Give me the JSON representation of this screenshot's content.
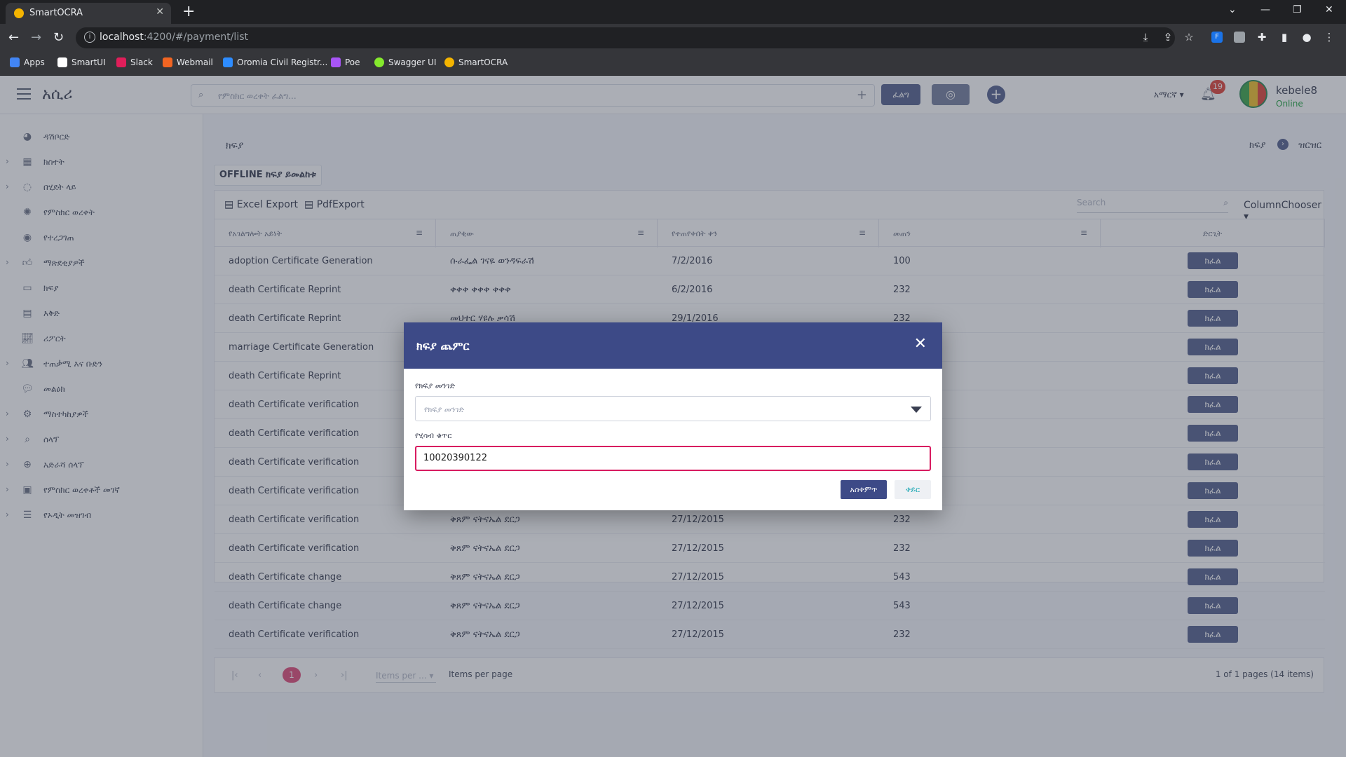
{
  "browser": {
    "tab_title": "SmartOCRA",
    "url_host": "localhost",
    "url_path": ":4200/#/payment/list",
    "bookmarks": [
      {
        "label": "Apps",
        "color": "#4285f4"
      },
      {
        "label": "SmartUI",
        "color": "#ffffff"
      },
      {
        "label": "Slack",
        "color": "#e01e5a"
      },
      {
        "label": "Webmail",
        "color": "#f26522"
      },
      {
        "label": "Oromia Civil Registr...",
        "color": "#2d8cff"
      },
      {
        "label": "Poe",
        "color": "#a855f7"
      },
      {
        "label": "Swagger UI",
        "color": "#85ea2d"
      },
      {
        "label": "SmartOCRA",
        "color": "#f4b400"
      }
    ]
  },
  "app": {
    "brand": "አሲሪ",
    "search_placeholder": "የምስክር ወረቀት ፈልግ...",
    "search_button": "ፈልግ",
    "language": "አማርኛ",
    "notifications": "19",
    "user": {
      "name": "kebele8",
      "status": "Online"
    }
  },
  "sidebar": {
    "items": [
      {
        "label": "ዳሽቦርድ",
        "icon": "dashboard-icon",
        "has_children": false
      },
      {
        "label": "ክስተት",
        "icon": "calendar-icon",
        "has_children": true
      },
      {
        "label": "በሂደት ላይ",
        "icon": "spinner-icon",
        "has_children": true
      },
      {
        "label": "የምስክር ወረቀት",
        "icon": "certificate-icon",
        "has_children": false
      },
      {
        "label": "የተረጋገጠ",
        "icon": "check-circle-icon",
        "has_children": false
      },
      {
        "label": "ማጽደቂያዎች",
        "icon": "thumbs-up-icon",
        "has_children": true
      },
      {
        "label": "ክፍያ",
        "icon": "credit-card-icon",
        "has_children": false
      },
      {
        "label": "እቅድ",
        "icon": "planner-icon",
        "has_children": false
      },
      {
        "label": "ሪፖርት",
        "icon": "chart-line-icon",
        "has_children": false
      },
      {
        "label": "ተጠቃሚ እና ቡድን",
        "icon": "users-icon",
        "has_children": true
      },
      {
        "label": "መልዕክ",
        "icon": "chat-icon",
        "has_children": false
      },
      {
        "label": "ማስተካከያዎች",
        "icon": "settings-icon",
        "has_children": true
      },
      {
        "label": "ሰላፕ",
        "icon": "zoom-icon",
        "has_children": true
      },
      {
        "label": "አድራሻ ሰላፕ",
        "icon": "zoom-plus-icon",
        "has_children": true
      },
      {
        "label": "የምስክር ወረቀቶች መገኛ",
        "icon": "archive-icon",
        "has_children": true
      },
      {
        "label": "የኦዲት መዝገብ",
        "icon": "list-icon",
        "has_children": true
      }
    ]
  },
  "page": {
    "title": "ክፍያ",
    "breadcrumb": [
      "ክፍያ",
      "ዝርዝር"
    ],
    "offline_button": "OFFLINE ክፍያ ይመልከቱ",
    "excel_export": "Excel Export",
    "pdf_export": "PdfExport",
    "grid_search_placeholder": "Search",
    "column_chooser": "ColumnChooser",
    "columns": [
      "የአገልግሎት አይነት",
      "ጠያቂው",
      "የተጠየቀበት ቀን",
      "መጠን",
      "ድርጊት"
    ],
    "pay_button": "ክፈል",
    "rows": [
      {
        "type": "adoption Certificate Generation",
        "requester": "ሱራፌል ገናዬ ወንዳፍራሽ",
        "date": "7/2/2016",
        "amount": "100"
      },
      {
        "type": "death Certificate Reprint",
        "requester": "ቀቀቀ ቀቀቀ ቀቀቀ",
        "date": "6/2/2016",
        "amount": "232"
      },
      {
        "type": "death Certificate Reprint",
        "requester": "መህተር ሃዩሉ ቃሳሽ",
        "date": "29/1/2016",
        "amount": "232"
      },
      {
        "type": "marriage Certificate Generation",
        "requester": "",
        "date": "",
        "amount": ""
      },
      {
        "type": "death Certificate Reprint",
        "requester": "",
        "date": "",
        "amount": ""
      },
      {
        "type": "death Certificate verification",
        "requester": "",
        "date": "",
        "amount": ""
      },
      {
        "type": "death Certificate verification",
        "requester": "",
        "date": "",
        "amount": ""
      },
      {
        "type": "death Certificate verification",
        "requester": "",
        "date": "",
        "amount": ""
      },
      {
        "type": "death Certificate verification",
        "requester": "",
        "date": "",
        "amount": ""
      },
      {
        "type": "death Certificate verification",
        "requester": "ቅጸም ናትናኤል ደርጋ",
        "date": "27/12/2015",
        "amount": "232"
      },
      {
        "type": "death Certificate verification",
        "requester": "ቅጸም ናትናኤል ደርጋ",
        "date": "27/12/2015",
        "amount": "232"
      },
      {
        "type": "death Certificate change",
        "requester": "ቅጸም ናትናኤል ደርጋ",
        "date": "27/12/2015",
        "amount": "543"
      },
      {
        "type": "death Certificate change",
        "requester": "ቅጸም ናትናኤል ደርጋ",
        "date": "27/12/2015",
        "amount": "543"
      },
      {
        "type": "death Certificate verification",
        "requester": "ቅጸም ናትናኤል ደርጋ",
        "date": "27/12/2015",
        "amount": "232"
      }
    ],
    "pager": {
      "current_page": "1",
      "items_per_page_placeholder": "Items per ...",
      "items_per_page_label": "Items per page",
      "summary": "1 of 1 pages (14 items)"
    }
  },
  "modal": {
    "title": "ክፍያ ጨምር",
    "method_label": "የክፍያ መንገድ",
    "method_placeholder": "የክፍያ መንገድ",
    "bill_label": "የሂሳብ ቁጥር",
    "bill_value": "10020390122",
    "ok_button": "አስቀምጥ",
    "cancel_button": "ቀይር"
  }
}
